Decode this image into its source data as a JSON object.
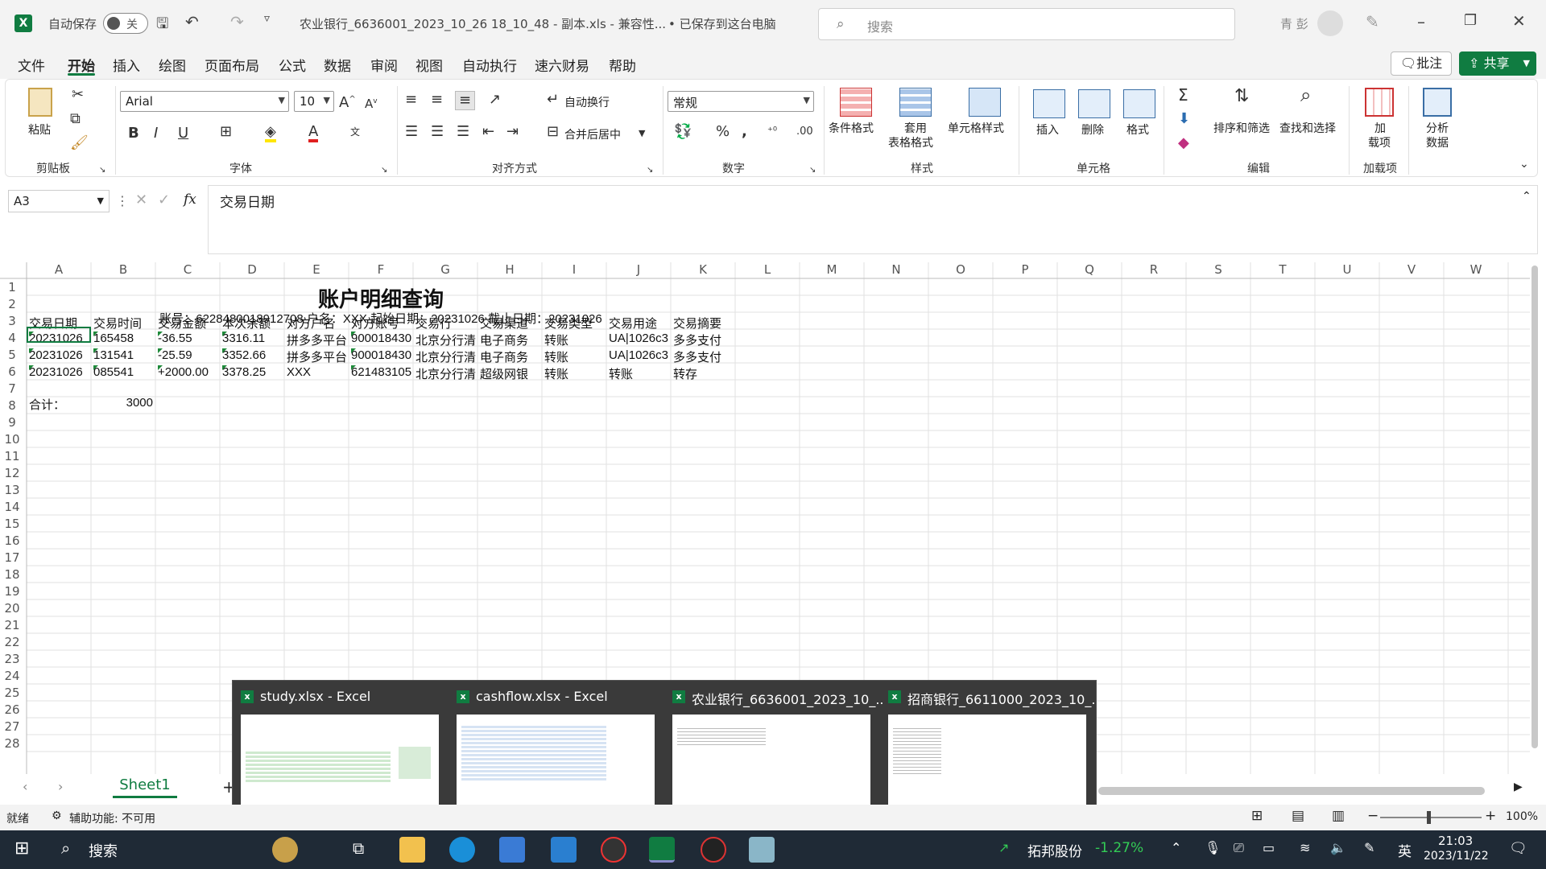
{
  "titlebar": {
    "autosave_label": "自动保存",
    "autosave_state": "关",
    "doc_title": "农业银行_6636001_2023_10_26 18_10_48 - 副本.xls  -  兼容性...",
    "save_status": "• 已保存到这台电脑",
    "search_placeholder": "搜索",
    "user": "青 彭"
  },
  "menu": {
    "items": [
      "文件",
      "开始",
      "插入",
      "绘图",
      "页面布局",
      "公式",
      "数据",
      "审阅",
      "视图",
      "自动执行",
      "速六财易",
      "帮助"
    ],
    "active": "开始",
    "comment_label": "批注",
    "share_label": "共享"
  },
  "ribbon": {
    "clipboard": {
      "paste": "粘贴",
      "group": "剪贴板"
    },
    "font": {
      "name": "Arial",
      "size": "10",
      "group": "字体"
    },
    "alignment": {
      "wrap": "自动换行",
      "merge": "合并后居中",
      "group": "对齐方式"
    },
    "number": {
      "format": "常规",
      "group": "数字"
    },
    "styles": {
      "conditional": "条件格式",
      "table_fmt_1": "套用",
      "table_fmt_2": "表格格式",
      "cell_styles": "单元格样式",
      "group": "样式"
    },
    "cells": {
      "insert": "插入",
      "delete": "删除",
      "format": "格式",
      "group": "单元格"
    },
    "editing": {
      "sort": "排序和筛选",
      "find": "查找和选择",
      "group": "编辑"
    },
    "addins": {
      "label_1": "加",
      "label_2": "载项",
      "group": "加载项"
    },
    "analyze": {
      "label_1": "分析",
      "label_2": "数据"
    }
  },
  "formula_bar": {
    "name_box": "A3",
    "fx": "fx",
    "content": "交易日期"
  },
  "grid": {
    "columns": [
      "A",
      "B",
      "C",
      "D",
      "E",
      "F",
      "G",
      "H",
      "I",
      "J",
      "K",
      "L",
      "M",
      "N",
      "O",
      "P",
      "Q",
      "R",
      "S",
      "T",
      "U",
      "V",
      "W"
    ],
    "rows": [
      "1",
      "2",
      "3",
      "4",
      "5",
      "6",
      "7",
      "8",
      "9",
      "10",
      "11",
      "12",
      "13",
      "14",
      "15",
      "16",
      "17",
      "18",
      "19",
      "20",
      "21",
      "22",
      "23",
      "24",
      "25",
      "26",
      "27",
      "28"
    ],
    "title": "账户明细查询",
    "info": "账号：6228480018912708 户名：XXX  起始日期：20231026  截止日期：20231026",
    "headers": [
      "交易日期",
      "交易时间",
      "交易金额",
      "本次余额",
      "对方户名",
      "对方账号",
      "交易行",
      "交易渠道",
      "交易类型",
      "交易用途",
      "交易摘要"
    ],
    "data": [
      [
        "20231026",
        "165458",
        "-36.55",
        "3316.11",
        "拼多多平台",
        "900018430",
        "北京分行清",
        "电子商务",
        "转账",
        "UA|1026c3",
        "多多支付"
      ],
      [
        "20231026",
        "131541",
        "-25.59",
        "3352.66",
        "拼多多平台",
        "900018430",
        "北京分行清",
        "电子商务",
        "转账",
        "UA|1026c3",
        "多多支付"
      ],
      [
        "20231026",
        "085541",
        "+2000.00",
        "3378.25",
        "XXX",
        "621483105",
        "北京分行清",
        "超级网银",
        "转账",
        "转账",
        "转存"
      ]
    ],
    "total_label": "合计：",
    "total_value": "3000"
  },
  "sheet": {
    "tab": "Sheet1"
  },
  "preview": {
    "windows": [
      "study.xlsx - Excel",
      "cashflow.xlsx - Excel",
      "农业银行_6636001_2023_10_...",
      "招商银行_6611000_2023_10_..."
    ]
  },
  "status": {
    "ready": "就绪",
    "accessibility": "辅助功能: 不可用",
    "zoom": "100%"
  },
  "taskbar": {
    "search": "搜索",
    "stock_name": "拓邦股份",
    "stock_change": "-1.27%",
    "ime": "英",
    "time": "21:03",
    "date": "2023/11/22"
  },
  "colors": {
    "excel_green": "#107c41",
    "taskbar": "#1f2a36",
    "stock_red": "#e04040"
  }
}
